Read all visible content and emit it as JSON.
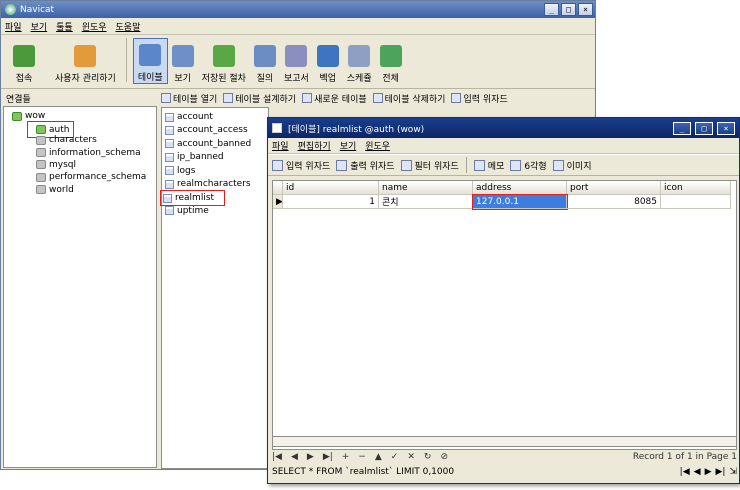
{
  "main_window": {
    "title": "Navicat",
    "controls": [
      "_",
      "□",
      "×"
    ],
    "menu": [
      "파일",
      "보기",
      "툴튤",
      "윈도우",
      "도움말"
    ],
    "toolbar": [
      {
        "label": "접속",
        "icon": "connect-icon",
        "color": "#4a9a3c"
      },
      {
        "label": "사용자 관리하기",
        "icon": "user-icon",
        "color": "#e39a3b"
      },
      {
        "label": "테이블",
        "icon": "table-icon",
        "color": "#5b86c9",
        "active": true
      },
      {
        "label": "보기",
        "icon": "view-icon",
        "color": "#6f8fc8"
      },
      {
        "label": "저장된 절차",
        "icon": "procedure-icon",
        "color": "#5aa843"
      },
      {
        "label": "질의",
        "icon": "query-icon",
        "color": "#6b8dc4"
      },
      {
        "label": "보고서",
        "icon": "report-icon",
        "color": "#8b8fbf"
      },
      {
        "label": "벡업",
        "icon": "backup-icon",
        "color": "#3f74c2"
      },
      {
        "label": "스케쥴",
        "icon": "schedule-icon",
        "color": "#8da0c4"
      },
      {
        "label": "전체",
        "icon": "all-icon",
        "color": "#4ea35a"
      }
    ]
  },
  "connections": {
    "header": "연결들",
    "root": "wow",
    "databases": [
      "auth",
      "characters",
      "information_schema",
      "mysql",
      "performance_schema",
      "world"
    ],
    "selected": "auth"
  },
  "object_toolbar": [
    "테이블 열기",
    "테이블 설계하기",
    "새로운 테이블",
    "테이블 삭제하기",
    "입력 위자드"
  ],
  "tables": [
    "account",
    "account_access",
    "account_banned",
    "ip_banned",
    "logs",
    "realmcharacters",
    "realmlist",
    "uptime"
  ],
  "selected_table": "realmlist",
  "table_window": {
    "title": "[테이블] realmlist @auth (wow)",
    "controls": [
      "_",
      "□",
      "×"
    ],
    "menu": [
      "파일",
      "편집하기",
      "보기",
      "윈도우"
    ],
    "toolbar": [
      "입력 위자드",
      "출력 위자드",
      "필터 위자드",
      "메모",
      "6각형",
      "이미지"
    ],
    "columns": [
      "id",
      "name",
      "address",
      "port",
      "icon"
    ],
    "rows": [
      [
        "1",
        "콘치",
        "127.0.0.1",
        "8085",
        ""
      ]
    ],
    "nav": [
      "|◀",
      "◀",
      "▶",
      "▶|",
      "+",
      "−",
      "▲",
      "✓",
      "✕",
      "↻",
      "⊘"
    ],
    "record_info": "Record 1 of 1 in Page 1",
    "sql": "SELECT * FROM `realmlist` LIMIT 0,1000",
    "page_nav": [
      "|◀",
      "◀",
      "▶",
      "▶|",
      "⇲"
    ]
  },
  "colors": {
    "highlight_red": "#e0201e",
    "selection_blue": "#3d7de0"
  }
}
